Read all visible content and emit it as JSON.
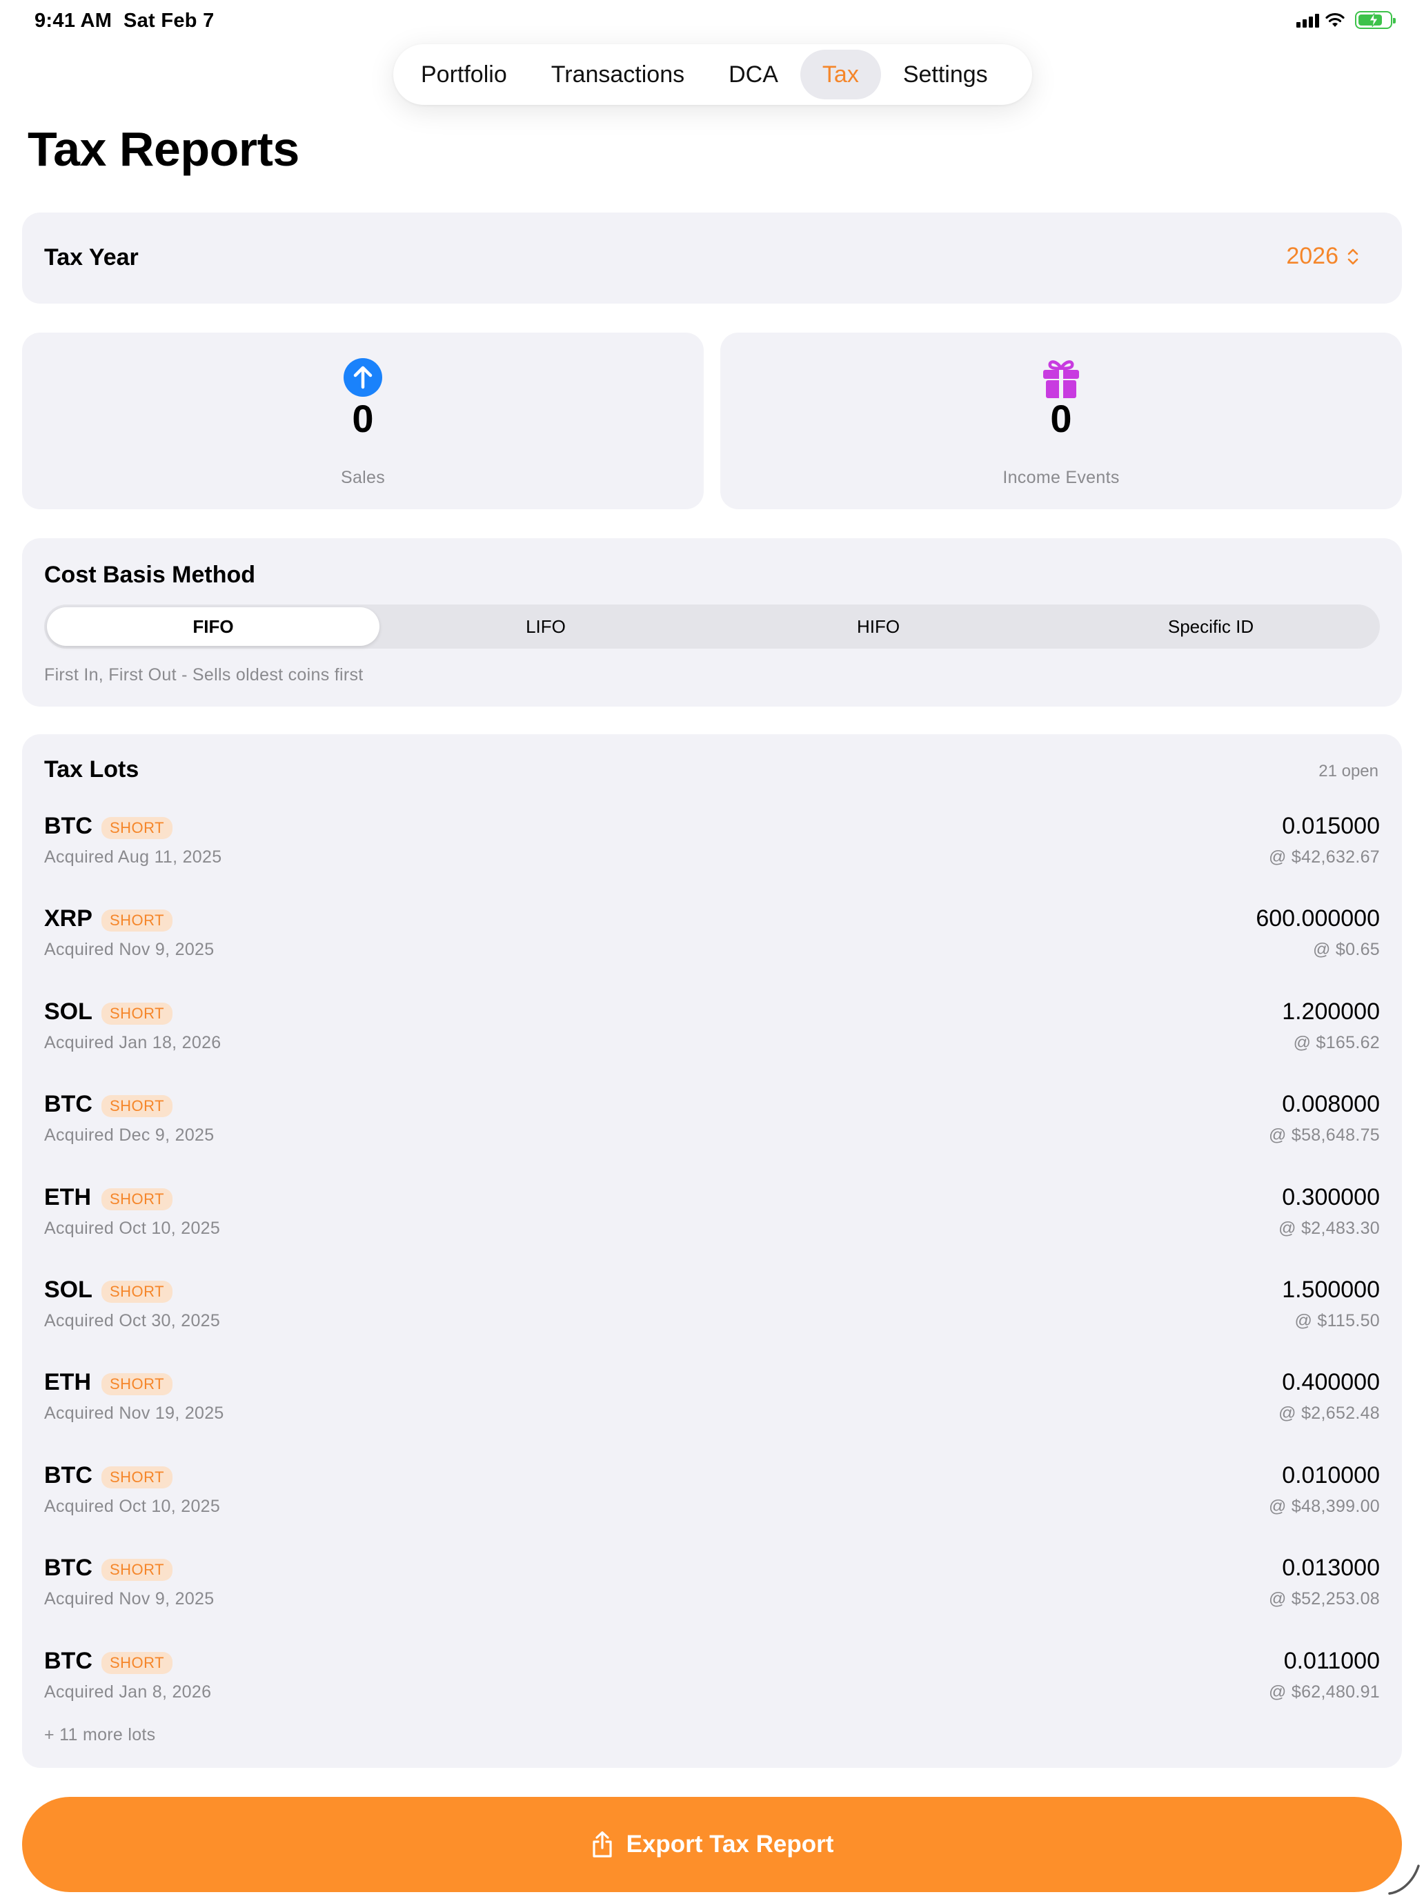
{
  "status": {
    "time": "9:41 AM",
    "date": "Sat Feb 7"
  },
  "tabs": [
    {
      "label": "Portfolio"
    },
    {
      "label": "Transactions"
    },
    {
      "label": "DCA"
    },
    {
      "label": "Tax",
      "active": true
    },
    {
      "label": "Settings"
    }
  ],
  "page": {
    "title": "Tax Reports"
  },
  "tax_year": {
    "label": "Tax Year",
    "value": "2026"
  },
  "stats": {
    "sales": {
      "value": "0",
      "label": "Sales",
      "icon": "arrow-up-circle-icon"
    },
    "income": {
      "value": "0",
      "label": "Income Events",
      "icon": "gift-icon"
    }
  },
  "cost_basis": {
    "label": "Cost Basis Method",
    "options": [
      "FIFO",
      "LIFO",
      "HIFO",
      "Specific ID"
    ],
    "selected": "FIFO",
    "description": "First In, First Out - Sells oldest coins first"
  },
  "lots": {
    "label": "Tax Lots",
    "count": "21 open",
    "items": [
      {
        "asset": "BTC",
        "term": "SHORT",
        "acquired": "Acquired Aug 11, 2025",
        "qty": "0.015000",
        "price": "@ $42,632.67"
      },
      {
        "asset": "XRP",
        "term": "SHORT",
        "acquired": "Acquired Nov 9, 2025",
        "qty": "600.000000",
        "price": "@ $0.65"
      },
      {
        "asset": "SOL",
        "term": "SHORT",
        "acquired": "Acquired Jan 18, 2026",
        "qty": "1.200000",
        "price": "@ $165.62"
      },
      {
        "asset": "BTC",
        "term": "SHORT",
        "acquired": "Acquired Dec 9, 2025",
        "qty": "0.008000",
        "price": "@ $58,648.75"
      },
      {
        "asset": "ETH",
        "term": "SHORT",
        "acquired": "Acquired Oct 10, 2025",
        "qty": "0.300000",
        "price": "@ $2,483.30"
      },
      {
        "asset": "SOL",
        "term": "SHORT",
        "acquired": "Acquired Oct 30, 2025",
        "qty": "1.500000",
        "price": "@ $115.50"
      },
      {
        "asset": "ETH",
        "term": "SHORT",
        "acquired": "Acquired Nov 19, 2025",
        "qty": "0.400000",
        "price": "@ $2,652.48"
      },
      {
        "asset": "BTC",
        "term": "SHORT",
        "acquired": "Acquired Oct 10, 2025",
        "qty": "0.010000",
        "price": "@ $48,399.00"
      },
      {
        "asset": "BTC",
        "term": "SHORT",
        "acquired": "Acquired Nov 9, 2025",
        "qty": "0.013000",
        "price": "@ $52,253.08"
      },
      {
        "asset": "BTC",
        "term": "SHORT",
        "acquired": "Acquired Jan 8, 2026",
        "qty": "0.011000",
        "price": "@ $62,480.91"
      }
    ],
    "more": "+ 11 more lots"
  },
  "export": {
    "label": "Export Tax Report",
    "icon": "share-icon"
  },
  "colors": {
    "accent": "#f5862a",
    "button": "#fd8f2a",
    "card": "#f2f2f7",
    "sales_icon": "#1a82fb",
    "income_icon": "#c83be0",
    "battery": "#3dc24a"
  }
}
